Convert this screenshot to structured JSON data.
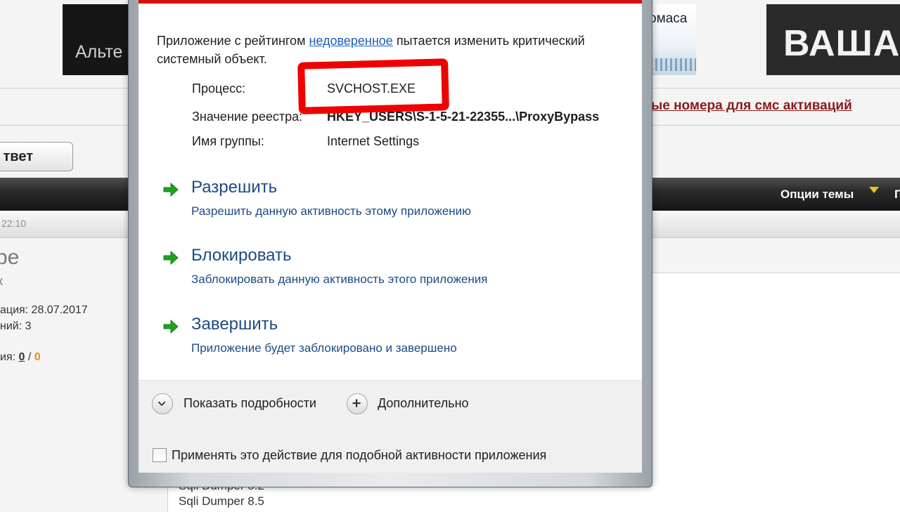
{
  "background": {
    "banner_left_text": "Альте",
    "banner_mid_text": "омаса",
    "banner_right_text": "ВАША Р",
    "sms_link": "ые номера для смс активаций",
    "reply_button": "твет",
    "thread_options": "Опции темы",
    "thread_options_more": "П",
    "post_time": "22:10",
    "username_fragment": "ре",
    "user_title_fragment": "к",
    "registration": "ация: 28.07.2017",
    "messages": "ний: 3",
    "reputation_label": "ия:",
    "reputation_pos": "0",
    "reputation_sep": "/",
    "reputation_neg": "0",
    "post_line1": "Sqli Dumper 8.2",
    "post_line2": "Sqli Dumper 8.5"
  },
  "dialog": {
    "intro_prefix": "Приложение с рейтингом ",
    "intro_link": "недоверенное",
    "intro_suffix": " пытается изменить критический системный объект.",
    "process_label": "Процесс:",
    "process_value": "SVCHOST.EXE",
    "registry_label": "Значение реестра:",
    "registry_value": "HKEY_USERS\\S-1-5-21-22355...\\ProxyBypass",
    "group_label": "Имя группы:",
    "group_value": "Internet Settings",
    "actions": [
      {
        "title": "Разрешить",
        "desc": "Разрешить данную активность этому приложению"
      },
      {
        "title": "Блокировать",
        "desc": "Заблокировать данную активность этого приложения"
      },
      {
        "title": "Завершить",
        "desc": "Приложение будет заблокировано и завершено"
      }
    ],
    "show_details": "Показать подробности",
    "advanced": "Дополнительно",
    "apply_checkbox": "Применять это действие для подобной активности приложения",
    "apply_checked": false
  },
  "colors": {
    "accent_red": "#d8100e",
    "link_blue": "#1a5fb4",
    "action_blue": "#1c4a86",
    "arrow_green": "#1fa11f",
    "annotation_red": "#f00000"
  }
}
